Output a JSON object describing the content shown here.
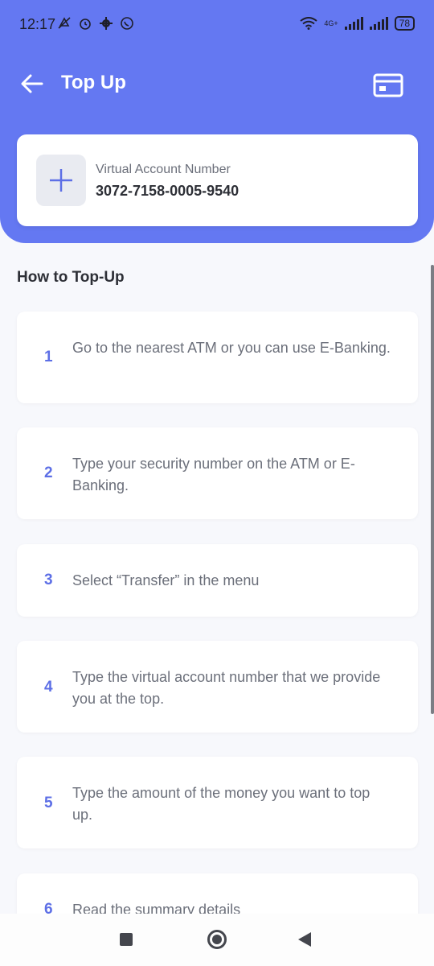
{
  "status_bar": {
    "time": "12:17",
    "network": "4G+",
    "battery": "78"
  },
  "header": {
    "title": "Top Up",
    "back_icon": "arrow-left-icon",
    "card_icon": "credit-card-icon"
  },
  "virtual_account": {
    "label": "Virtual Account Number",
    "number": "3072-7158-0005-9540"
  },
  "section_title": "How to Top-Up",
  "steps": [
    {
      "number": "1",
      "text": "Go to the nearest ATM or you can use E-Banking."
    },
    {
      "number": "2",
      "text": "Type your security number on the ATM or E-Banking."
    },
    {
      "number": "3",
      "text": "Select “Transfer” in the menu"
    },
    {
      "number": "4",
      "text": "Type the virtual account number that we provide you at the top."
    },
    {
      "number": "5",
      "text": "Type the amount of the money you want to top up."
    },
    {
      "number": "6",
      "text": "Read the summary details"
    }
  ],
  "colors": {
    "primary": "#6478f2",
    "accent_number": "#5d6fe6",
    "background": "#f7f8fc"
  }
}
